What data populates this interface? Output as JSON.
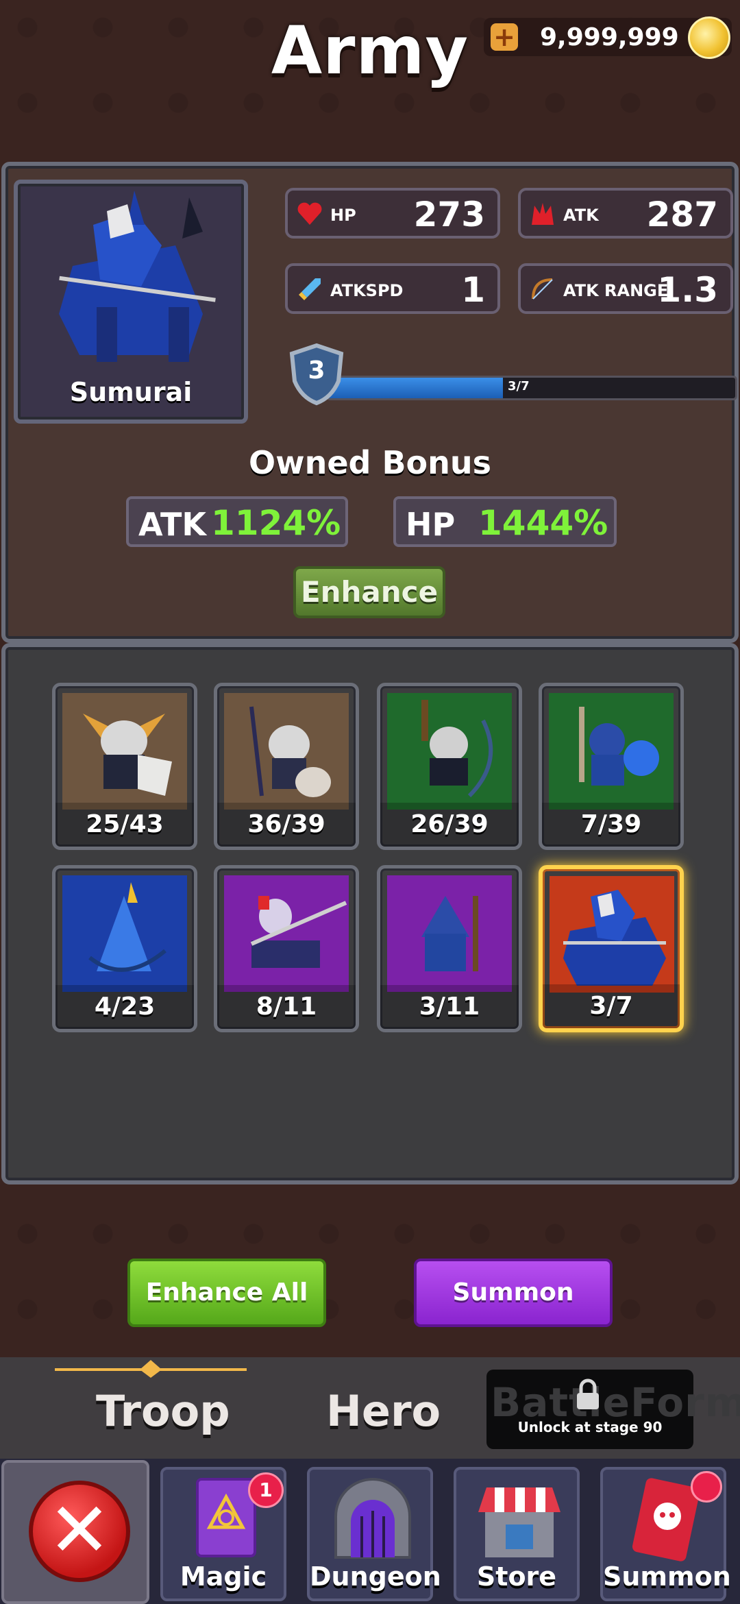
{
  "header": {
    "title": "Army",
    "currency": "9,999,999"
  },
  "unit": {
    "name": "Sumurai",
    "stats": {
      "hp_label": "HP",
      "hp": "273",
      "atk_label": "ATK",
      "atk": "287",
      "atkspd_label": "ATKSPD",
      "atkspd": "1",
      "range_label": "ATK RANGE",
      "range": "1.3"
    },
    "level": "3",
    "progress_text": "3/7",
    "progress": 0.43
  },
  "owned_bonus": {
    "title": "Owned Bonus",
    "atk_label": "ATK",
    "atk_value": "1124%",
    "hp_label": "HP",
    "hp_value": "1444%",
    "enhance_label": "Enhance"
  },
  "troops": [
    {
      "count": "25/43",
      "bg": "#6e5640"
    },
    {
      "count": "36/39",
      "bg": "#6e5640"
    },
    {
      "count": "26/39",
      "bg": "#1f6a2c"
    },
    {
      "count": "7/39",
      "bg": "#1f6a2c"
    },
    {
      "count": "4/23",
      "bg": "#1c3fa8"
    },
    {
      "count": "8/11",
      "bg": "#7b22a8"
    },
    {
      "count": "3/11",
      "bg": "#7b22a8"
    },
    {
      "count": "3/7",
      "bg": "#c53a1a"
    }
  ],
  "actions": {
    "enhance_all": "Enhance All",
    "summon": "Summon"
  },
  "tabs": {
    "troop": "Troop",
    "hero": "Hero",
    "battle_form": "BattleForm",
    "battle_form_locked": "Unlock at stage 90"
  },
  "nav": {
    "magic": "Magic",
    "magic_badge": "1",
    "dungeon": "Dungeon",
    "store": "Store",
    "summon": "Summon"
  }
}
